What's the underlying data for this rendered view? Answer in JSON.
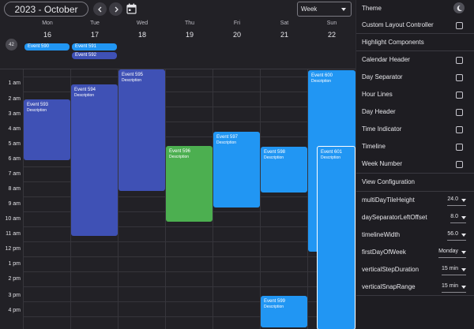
{
  "toolbar": {
    "month_label": "2023 - October",
    "prev_icon": "chevron-left-icon",
    "next_icon": "chevron-right-icon",
    "calendar_icon": "calendar-icon",
    "view_value": "Week"
  },
  "days": [
    {
      "name": "Mon",
      "num": "16"
    },
    {
      "name": "Tue",
      "num": "17"
    },
    {
      "name": "Wed",
      "num": "18"
    },
    {
      "name": "Thu",
      "num": "19"
    },
    {
      "name": "Fri",
      "num": "20"
    },
    {
      "name": "Sat",
      "num": "21"
    },
    {
      "name": "Sun",
      "num": "22"
    }
  ],
  "week_number": "42",
  "all_day_events": [
    {
      "title": "Event 590",
      "color": "#2196f3"
    },
    {
      "title": "Event 591",
      "color": "#2196f3"
    },
    {
      "title": "Event 592",
      "color": "#3f51b5"
    }
  ],
  "hours": [
    "1 am",
    "2 am",
    "3 am",
    "4 am",
    "5 am",
    "6 am",
    "7 am",
    "8 am",
    "9 am",
    "10 am",
    "11 am",
    "12 pm",
    "1 pm",
    "2 pm",
    "3 pm",
    "4 pm"
  ],
  "events": [
    {
      "title": "Event 593",
      "desc": "Description",
      "color": "indigo"
    },
    {
      "title": "Event 594",
      "desc": "Description",
      "color": "indigo"
    },
    {
      "title": "Event 595",
      "desc": "Description",
      "color": "indigo"
    },
    {
      "title": "Event 596",
      "desc": "Description",
      "color": "green"
    },
    {
      "title": "Event 597",
      "desc": "Description",
      "color": "blue"
    },
    {
      "title": "Event 598",
      "desc": "Description",
      "color": "blue"
    },
    {
      "title": "Event 599",
      "desc": "Description",
      "color": "blue"
    },
    {
      "title": "Event 600",
      "desc": "Description",
      "color": "blue"
    },
    {
      "title": "Event 601",
      "desc": "Description",
      "color": "blue"
    }
  ],
  "panel": {
    "theme_label": "Theme",
    "theme_icon": "dark-mode-icon",
    "custom_layout_label": "Custom Layout Controller",
    "highlight_header": "Highlight Components",
    "highlight_items": [
      "Calendar Header",
      "Day Separator",
      "Hour Lines",
      "Day Header",
      "Time Indicator",
      "Timeline",
      "Week Number"
    ],
    "view_config_header": "View Configuration",
    "config": [
      {
        "label": "multiDayTileHeight",
        "value": "24.0"
      },
      {
        "label": "daySeparatorLeftOffset",
        "value": "8.0"
      },
      {
        "label": "timelineWidth",
        "value": "56.0"
      },
      {
        "label": "firstDayOfWeek",
        "value": "Monday"
      },
      {
        "label": "verticalStepDuration",
        "value": "15 min"
      },
      {
        "label": "verticalSnapRange",
        "value": "15 min"
      }
    ]
  },
  "colors": {
    "accent_indigo": "#3f51b5",
    "accent_blue": "#2196f3",
    "accent_green": "#4caf50",
    "background": "#222126"
  }
}
